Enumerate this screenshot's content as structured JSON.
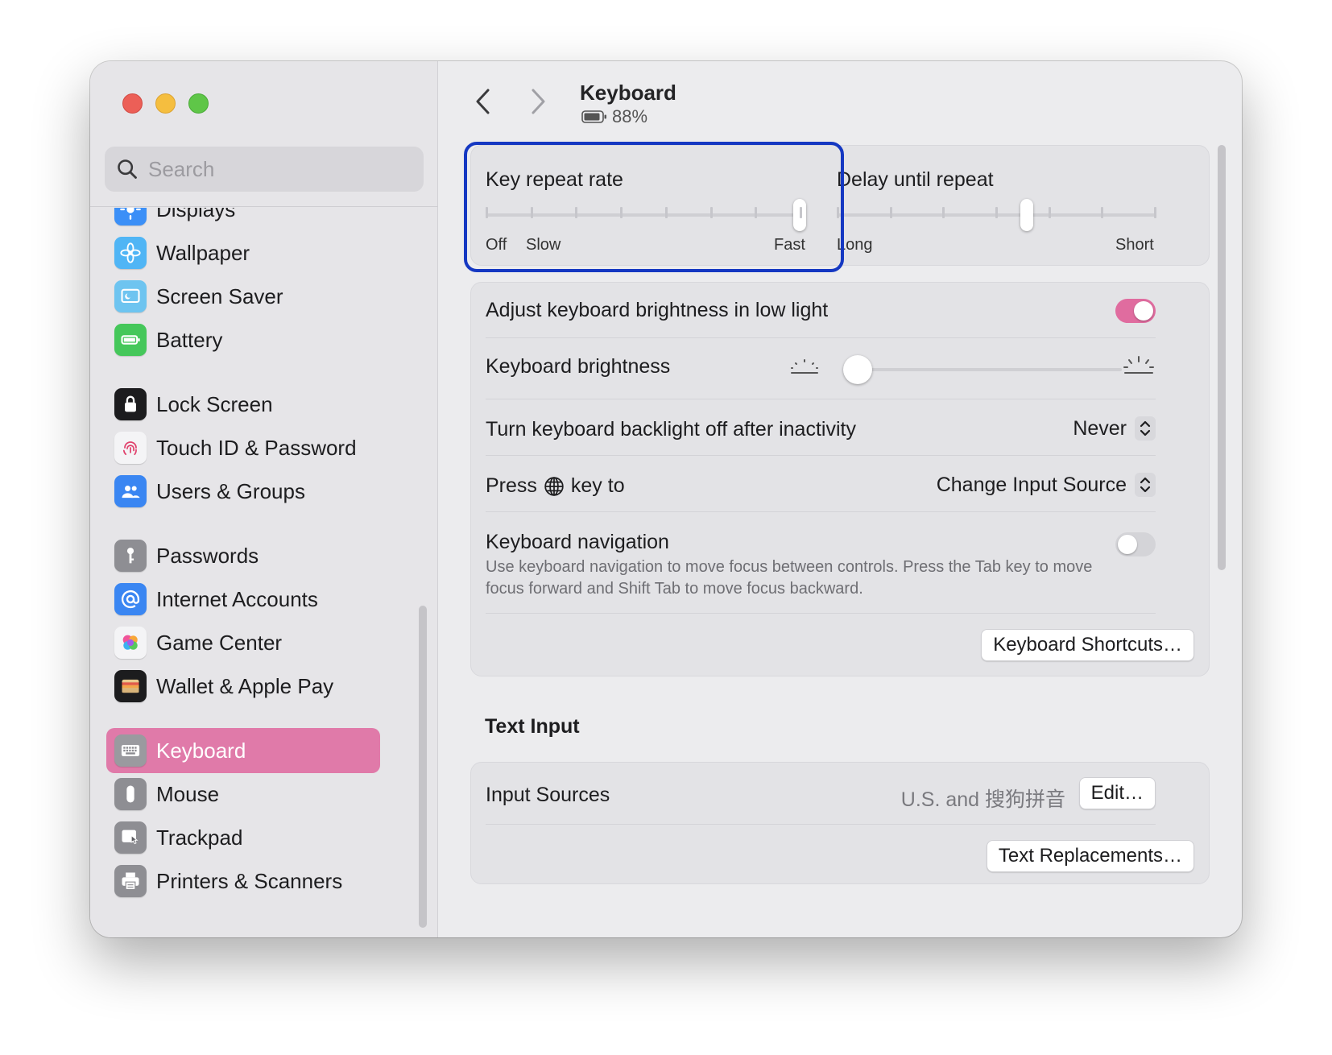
{
  "window": {
    "search_placeholder": "Search"
  },
  "sidebar": {
    "items": [
      {
        "label": "Displays",
        "icon": "displays-icon",
        "color": "#3b8ff7"
      },
      {
        "label": "Wallpaper",
        "icon": "wallpaper-icon",
        "color": "#50b5f5"
      },
      {
        "label": "Screen Saver",
        "icon": "screen-saver-icon",
        "color": "#6ec4f0"
      },
      {
        "label": "Battery",
        "icon": "battery-icon",
        "color": "#45c75a"
      },
      {
        "label": "Lock Screen",
        "icon": "lock-icon",
        "color": "#1c1c1e"
      },
      {
        "label": "Touch ID & Password",
        "icon": "fingerprint-icon",
        "color": "#f4f4f6"
      },
      {
        "label": "Users & Groups",
        "icon": "users-icon",
        "color": "#3a86f2"
      },
      {
        "label": "Passwords",
        "icon": "key-icon",
        "color": "#8e8e93"
      },
      {
        "label": "Internet Accounts",
        "icon": "at-icon",
        "color": "#3a86f2"
      },
      {
        "label": "Game Center",
        "icon": "game-center-icon",
        "color": "#f4f4f6"
      },
      {
        "label": "Wallet & Apple Pay",
        "icon": "wallet-icon",
        "color": "#1c1c1e"
      },
      {
        "label": "Keyboard",
        "icon": "keyboard-icon",
        "color": "#9a9a9f"
      },
      {
        "label": "Mouse",
        "icon": "mouse-icon",
        "color": "#8e8e93"
      },
      {
        "label": "Trackpad",
        "icon": "trackpad-icon",
        "color": "#8e8e93"
      },
      {
        "label": "Printers & Scanners",
        "icon": "printer-icon",
        "color": "#8e8e93"
      }
    ],
    "selected": "Keyboard",
    "selected_color": "#e07aa9"
  },
  "header": {
    "title": "Keyboard",
    "battery": "88%"
  },
  "repeat": {
    "key_repeat_title": "Key repeat rate",
    "key_repeat_labels": {
      "off": "Off",
      "slow": "Slow",
      "fast": "Fast"
    },
    "key_repeat_value": 1.0,
    "delay_title": "Delay until repeat",
    "delay_labels": {
      "long": "Long",
      "short": "Short"
    },
    "delay_value": 0.6
  },
  "settings": {
    "adjust_brightness_label": "Adjust keyboard brightness in low light",
    "adjust_brightness_on": true,
    "brightness_label": "Keyboard brightness",
    "brightness_value": 0.0,
    "backlight_label": "Turn keyboard backlight off after inactivity",
    "backlight_value": "Never",
    "press_key_prefix": "Press",
    "press_key_suffix": "key to",
    "press_key_value": "Change Input Source",
    "nav_label": "Keyboard navigation",
    "nav_on": false,
    "nav_help": "Use keyboard navigation to move focus between controls. Press the Tab key to move focus forward and Shift Tab to move focus backward.",
    "shortcuts_button": "Keyboard Shortcuts…"
  },
  "text_input": {
    "section_title": "Text Input",
    "input_sources_label": "Input Sources",
    "input_sources_value": "U.S. and 搜狗拼音",
    "edit_button": "Edit…",
    "replacements_button": "Text Replacements…"
  },
  "colors": {
    "accent": "#e06c9f",
    "focus_ring": "#1538c2"
  }
}
